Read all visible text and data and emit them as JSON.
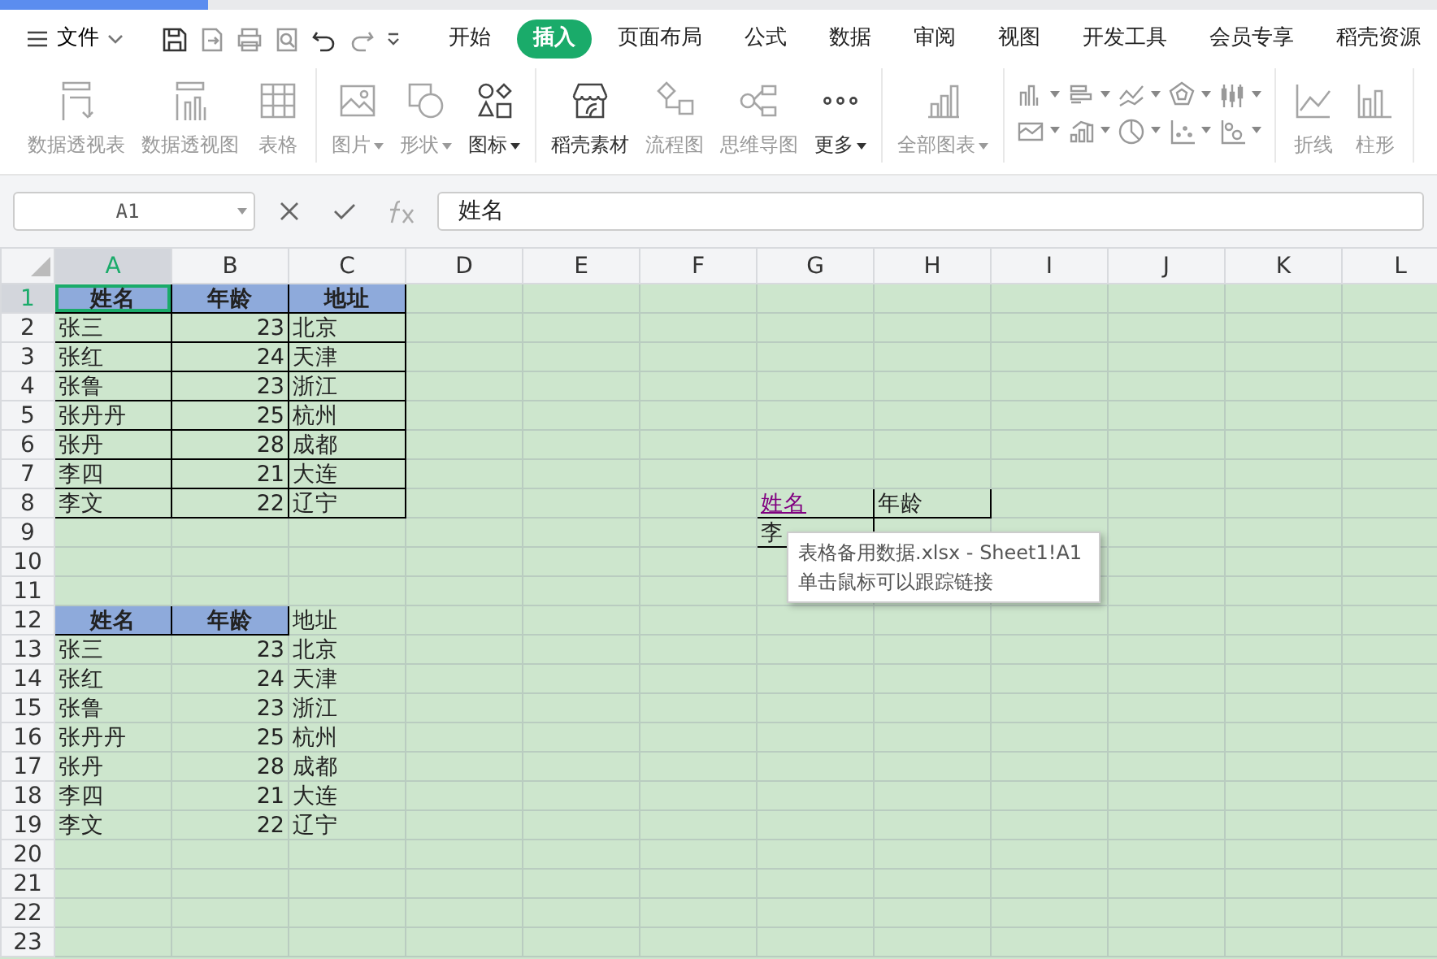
{
  "menu": {
    "label": "文件"
  },
  "tabs": [
    {
      "label": "开始",
      "selected": false
    },
    {
      "label": "插入",
      "selected": true
    },
    {
      "label": "页面布局",
      "selected": false
    },
    {
      "label": "公式",
      "selected": false
    },
    {
      "label": "数据",
      "selected": false
    },
    {
      "label": "审阅",
      "selected": false
    },
    {
      "label": "视图",
      "selected": false
    },
    {
      "label": "开发工具",
      "selected": false
    },
    {
      "label": "会员专享",
      "selected": false
    },
    {
      "label": "稻壳资源",
      "selected": false
    }
  ],
  "ribbon": {
    "groups": [
      {
        "items": [
          {
            "label": "数据透视表",
            "disabled": true,
            "dropdown": false
          },
          {
            "label": "数据透视图",
            "disabled": true,
            "dropdown": false
          },
          {
            "label": "表格",
            "disabled": true,
            "dropdown": false
          }
        ]
      },
      {
        "items": [
          {
            "label": "图片",
            "disabled": true,
            "dropdown": true
          },
          {
            "label": "形状",
            "disabled": true,
            "dropdown": true
          },
          {
            "label": "图标",
            "disabled": false,
            "dropdown": true
          }
        ]
      },
      {
        "items": [
          {
            "label": "稻壳素材",
            "disabled": false,
            "dropdown": false
          },
          {
            "label": "流程图",
            "disabled": true,
            "dropdown": false
          },
          {
            "label": "思维导图",
            "disabled": true,
            "dropdown": false
          },
          {
            "label": "更多",
            "disabled": false,
            "dropdown": true
          }
        ]
      },
      {
        "items": [
          {
            "label": "全部图表",
            "disabled": true,
            "dropdown": true
          }
        ]
      },
      {
        "items": [
          {
            "label": "折线",
            "disabled": true,
            "dropdown": false
          },
          {
            "label": "柱形",
            "disabled": true,
            "dropdown": false
          }
        ]
      }
    ]
  },
  "formula_bar": {
    "name_box": "A1",
    "formula": "姓名"
  },
  "sheet": {
    "columns": [
      {
        "label": "A",
        "selected": true
      },
      {
        "label": "B",
        "selected": false
      },
      {
        "label": "C",
        "selected": false
      },
      {
        "label": "D",
        "selected": false
      },
      {
        "label": "E",
        "selected": false
      },
      {
        "label": "F",
        "selected": false
      },
      {
        "label": "G",
        "selected": false
      },
      {
        "label": "H",
        "selected": false
      },
      {
        "label": "I",
        "selected": false
      },
      {
        "label": "J",
        "selected": false
      },
      {
        "label": "K",
        "selected": false
      },
      {
        "label": "L",
        "selected": false
      }
    ],
    "rows": [
      {
        "number": "1",
        "selected": true,
        "cells": [
          {
            "text": "姓名",
            "kind": "header",
            "bordered": true
          },
          {
            "text": "年龄",
            "kind": "header",
            "bordered": true
          },
          {
            "text": "地址",
            "kind": "header",
            "bordered": true
          }
        ]
      },
      {
        "number": "2",
        "selected": false,
        "cells": [
          {
            "text": "张三",
            "kind": "text",
            "bordered": true
          },
          {
            "text": "23",
            "kind": "number",
            "bordered": true
          },
          {
            "text": "北京",
            "kind": "text",
            "bordered": true
          }
        ]
      },
      {
        "number": "3",
        "selected": false,
        "cells": [
          {
            "text": "张红",
            "kind": "text",
            "bordered": true
          },
          {
            "text": "24",
            "kind": "number",
            "bordered": true
          },
          {
            "text": "天津",
            "kind": "text",
            "bordered": true
          }
        ]
      },
      {
        "number": "4",
        "selected": false,
        "cells": [
          {
            "text": "张鲁",
            "kind": "text",
            "bordered": true
          },
          {
            "text": "23",
            "kind": "number",
            "bordered": true
          },
          {
            "text": "浙江",
            "kind": "text",
            "bordered": true
          }
        ]
      },
      {
        "number": "5",
        "selected": false,
        "cells": [
          {
            "text": "张丹丹",
            "kind": "text",
            "bordered": true
          },
          {
            "text": "25",
            "kind": "number",
            "bordered": true
          },
          {
            "text": "杭州",
            "kind": "text",
            "bordered": true
          }
        ]
      },
      {
        "number": "6",
        "selected": false,
        "cells": [
          {
            "text": "张丹",
            "kind": "text",
            "bordered": true
          },
          {
            "text": "28",
            "kind": "number",
            "bordered": true
          },
          {
            "text": "成都",
            "kind": "text",
            "bordered": true
          }
        ]
      },
      {
        "number": "7",
        "selected": false,
        "cells": [
          {
            "text": "李四",
            "kind": "text",
            "bordered": true
          },
          {
            "text": "21",
            "kind": "number",
            "bordered": true
          },
          {
            "text": "大连",
            "kind": "text",
            "bordered": true
          }
        ]
      },
      {
        "number": "8",
        "selected": false,
        "cells": [
          {
            "text": "李文",
            "kind": "text",
            "bordered": true
          },
          {
            "text": "22",
            "kind": "number",
            "bordered": true
          },
          {
            "text": "辽宁",
            "kind": "text",
            "bordered": true
          },
          {},
          {},
          {},
          {
            "text": "姓名",
            "kind": "link",
            "bordered": true
          },
          {
            "text": "年龄",
            "kind": "text",
            "bordered": true
          }
        ]
      },
      {
        "number": "9",
        "selected": false,
        "cells": [
          {},
          {},
          {},
          {},
          {},
          {},
          {
            "text": "李",
            "kind": "text",
            "bordered": true
          }
        ]
      },
      {
        "number": "10",
        "selected": false,
        "cells": []
      },
      {
        "number": "11",
        "selected": false,
        "cells": []
      },
      {
        "number": "12",
        "selected": false,
        "cells": [
          {
            "text": "姓名",
            "kind": "header",
            "bordered": true
          },
          {
            "text": "年龄",
            "kind": "header",
            "bordered": true
          },
          {
            "text": "地址",
            "kind": "text",
            "bordered": false
          }
        ]
      },
      {
        "number": "13",
        "selected": false,
        "cells": [
          {
            "text": "张三",
            "kind": "text",
            "bordered": false
          },
          {
            "text": "23",
            "kind": "number",
            "bordered": false
          },
          {
            "text": "北京",
            "kind": "text",
            "bordered": false
          }
        ]
      },
      {
        "number": "14",
        "selected": false,
        "cells": [
          {
            "text": "张红",
            "kind": "text",
            "bordered": false
          },
          {
            "text": "24",
            "kind": "number",
            "bordered": false
          },
          {
            "text": "天津",
            "kind": "text",
            "bordered": false
          }
        ]
      },
      {
        "number": "15",
        "selected": false,
        "cells": [
          {
            "text": "张鲁",
            "kind": "text",
            "bordered": false
          },
          {
            "text": "23",
            "kind": "number",
            "bordered": false
          },
          {
            "text": "浙江",
            "kind": "text",
            "bordered": false
          }
        ]
      },
      {
        "number": "16",
        "selected": false,
        "cells": [
          {
            "text": "张丹丹",
            "kind": "text",
            "bordered": false
          },
          {
            "text": "25",
            "kind": "number",
            "bordered": false
          },
          {
            "text": "杭州",
            "kind": "text",
            "bordered": false
          }
        ]
      },
      {
        "number": "17",
        "selected": false,
        "cells": [
          {
            "text": "张丹",
            "kind": "text",
            "bordered": false
          },
          {
            "text": "28",
            "kind": "number",
            "bordered": false
          },
          {
            "text": "成都",
            "kind": "text",
            "bordered": false
          }
        ]
      },
      {
        "number": "18",
        "selected": false,
        "cells": [
          {
            "text": "李四",
            "kind": "text",
            "bordered": false
          },
          {
            "text": "21",
            "kind": "number",
            "bordered": false
          },
          {
            "text": "大连",
            "kind": "text",
            "bordered": false
          }
        ]
      },
      {
        "number": "19",
        "selected": false,
        "cells": [
          {
            "text": "李文",
            "kind": "text",
            "bordered": false
          },
          {
            "text": "22",
            "kind": "number",
            "bordered": false
          },
          {
            "text": "辽宁",
            "kind": "text",
            "bordered": false
          }
        ]
      },
      {
        "number": "20",
        "selected": false,
        "cells": []
      },
      {
        "number": "21",
        "selected": false,
        "cells": []
      },
      {
        "number": "22",
        "selected": false,
        "cells": []
      },
      {
        "number": "23",
        "selected": false,
        "cells": []
      }
    ]
  },
  "tooltip": {
    "lines": [
      "表格备用数据.xlsx - Sheet1!A1",
      "单击鼠标可以跟踪链接"
    ]
  }
}
